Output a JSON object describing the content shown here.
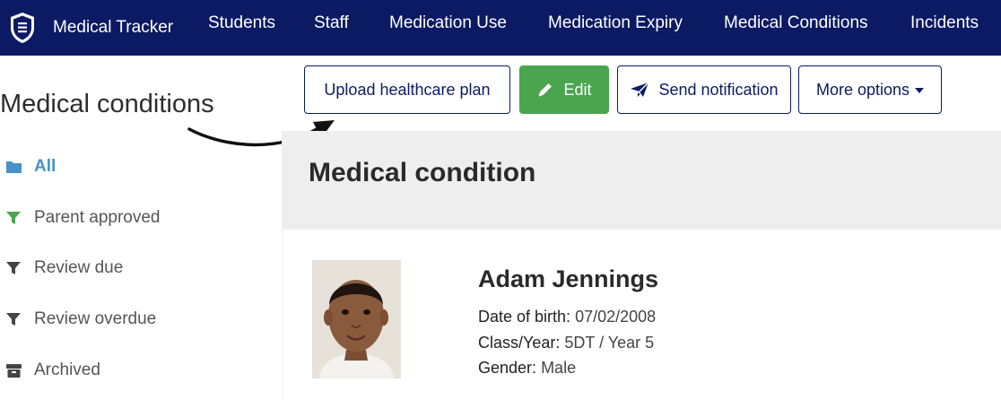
{
  "navbar": {
    "brand": "Medical Tracker",
    "items": [
      {
        "label": "Students"
      },
      {
        "label": "Staff"
      },
      {
        "label": "Medication Use"
      },
      {
        "label": "Medication Expiry"
      },
      {
        "label": "Medical Conditions"
      },
      {
        "label": "Incidents"
      }
    ]
  },
  "page": {
    "heading": "Medical conditions"
  },
  "toolbar": {
    "upload_label": "Upload healthcare plan",
    "edit_label": "Edit",
    "notify_label": "Send notification",
    "more_label": "More options"
  },
  "sidebar": {
    "items": [
      {
        "label": "All",
        "icon": "folder-icon",
        "active": true
      },
      {
        "label": "Parent approved",
        "icon": "filter-icon"
      },
      {
        "label": "Review due",
        "icon": "filter-icon"
      },
      {
        "label": "Review overdue",
        "icon": "filter-icon"
      },
      {
        "label": "Archived",
        "icon": "archive-icon"
      }
    ]
  },
  "panel": {
    "title": "Medical condition"
  },
  "student": {
    "name": "Adam Jennings",
    "dob_label": "Date of birth:",
    "dob": "07/02/2008",
    "class_label": "Class/Year:",
    "class": "5DT / Year 5",
    "gender_label": "Gender:",
    "gender": "Male"
  },
  "colors": {
    "navbar": "#0b1a63",
    "edit_button": "#4aa54e",
    "active_link": "#4a90c8",
    "filter_approved": "#4aa54e",
    "panel_header": "#eeeeee"
  }
}
